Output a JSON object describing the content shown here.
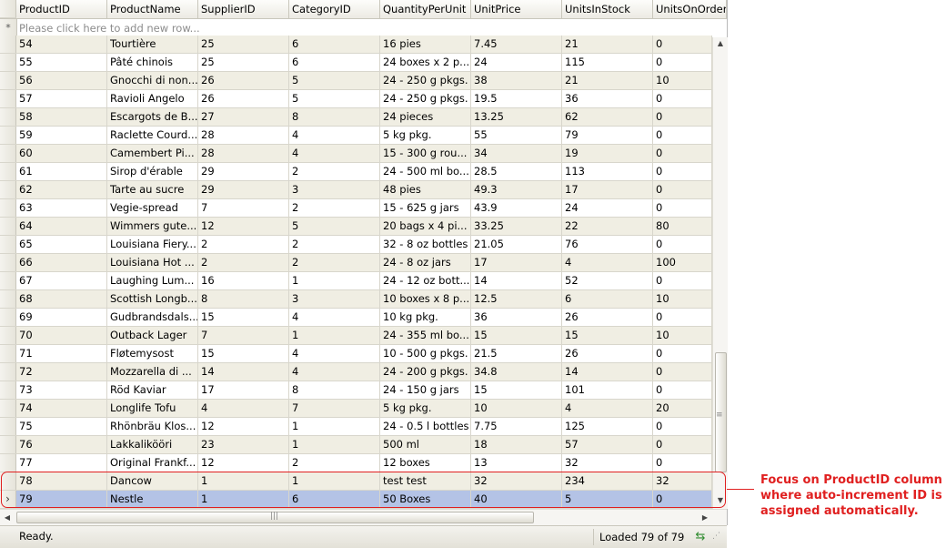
{
  "columns": [
    "ProductID",
    "ProductName",
    "SupplierID",
    "CategoryID",
    "QuantityPerUnit",
    "UnitPrice",
    "UnitsInStock",
    "UnitsOnOrder"
  ],
  "new_row": {
    "marker": "*",
    "placeholder": "Please click here to add new row..."
  },
  "rows": [
    [
      "54",
      "Tourtière",
      "25",
      "6",
      "16 pies",
      "7.45",
      "21",
      "0"
    ],
    [
      "55",
      "Pâté chinois",
      "25",
      "6",
      "24 boxes x 2 p...",
      "24",
      "115",
      "0"
    ],
    [
      "56",
      "Gnocchi di non...",
      "26",
      "5",
      "24 - 250 g pkgs.",
      "38",
      "21",
      "10"
    ],
    [
      "57",
      "Ravioli Angelo",
      "26",
      "5",
      "24 - 250 g pkgs.",
      "19.5",
      "36",
      "0"
    ],
    [
      "58",
      "Escargots de B...",
      "27",
      "8",
      "24 pieces",
      "13.25",
      "62",
      "0"
    ],
    [
      "59",
      "Raclette Courd...",
      "28",
      "4",
      "5 kg pkg.",
      "55",
      "79",
      "0"
    ],
    [
      "60",
      "Camembert Pi...",
      "28",
      "4",
      "15 - 300 g rou...",
      "34",
      "19",
      "0"
    ],
    [
      "61",
      "Sirop d'érable",
      "29",
      "2",
      "24 - 500 ml bo...",
      "28.5",
      "113",
      "0"
    ],
    [
      "62",
      "Tarte au sucre",
      "29",
      "3",
      "48 pies",
      "49.3",
      "17",
      "0"
    ],
    [
      "63",
      "Vegie-spread",
      "7",
      "2",
      "15 - 625 g jars",
      "43.9",
      "24",
      "0"
    ],
    [
      "64",
      "Wimmers gute...",
      "12",
      "5",
      "20 bags x 4 pi...",
      "33.25",
      "22",
      "80"
    ],
    [
      "65",
      "Louisiana Fiery...",
      "2",
      "2",
      "32 - 8 oz bottles",
      "21.05",
      "76",
      "0"
    ],
    [
      "66",
      "Louisiana Hot ...",
      "2",
      "2",
      "24 - 8 oz jars",
      "17",
      "4",
      "100"
    ],
    [
      "67",
      "Laughing Lum...",
      "16",
      "1",
      "24 - 12 oz bott...",
      "14",
      "52",
      "0"
    ],
    [
      "68",
      "Scottish Longb...",
      "8",
      "3",
      "10 boxes x 8 p...",
      "12.5",
      "6",
      "10"
    ],
    [
      "69",
      "Gudbrandsdals...",
      "15",
      "4",
      "10 kg pkg.",
      "36",
      "26",
      "0"
    ],
    [
      "70",
      "Outback Lager",
      "7",
      "1",
      "24 - 355 ml bo...",
      "15",
      "15",
      "10"
    ],
    [
      "71",
      "Fløtemysost",
      "15",
      "4",
      "10 - 500 g pkgs.",
      "21.5",
      "26",
      "0"
    ],
    [
      "72",
      "Mozzarella di ...",
      "14",
      "4",
      "24 - 200 g pkgs.",
      "34.8",
      "14",
      "0"
    ],
    [
      "73",
      "Röd Kaviar",
      "17",
      "8",
      "24 - 150 g jars",
      "15",
      "101",
      "0"
    ],
    [
      "74",
      "Longlife Tofu",
      "4",
      "7",
      "5 kg pkg.",
      "10",
      "4",
      "20"
    ],
    [
      "75",
      "Rhönbräu Klos...",
      "12",
      "1",
      "24 - 0.5 l bottles",
      "7.75",
      "125",
      "0"
    ],
    [
      "76",
      "Lakkalikööri",
      "23",
      "1",
      "500 ml",
      "18",
      "57",
      "0"
    ],
    [
      "77",
      "Original Frankf...",
      "12",
      "2",
      "12 boxes",
      "13",
      "32",
      "0"
    ],
    [
      "78",
      "Dancow",
      "1",
      "1",
      "test test",
      "32",
      "234",
      "32"
    ],
    [
      "79",
      "Nestle",
      "1",
      "6",
      "50 Boxes",
      "40",
      "5",
      "0"
    ]
  ],
  "selected_row_marker": "›",
  "status": {
    "text": "Ready.",
    "loaded": "Loaded 79 of 79",
    "refresh_icon": "refresh-icon"
  },
  "annotation": {
    "lines": [
      "Focus on ProductID column",
      "where auto-increment ID is",
      "assigned automatically."
    ],
    "color": "#e02020"
  },
  "colors": {
    "row_alt": "#f0eee3",
    "row_selected": "#b4c3e6"
  }
}
